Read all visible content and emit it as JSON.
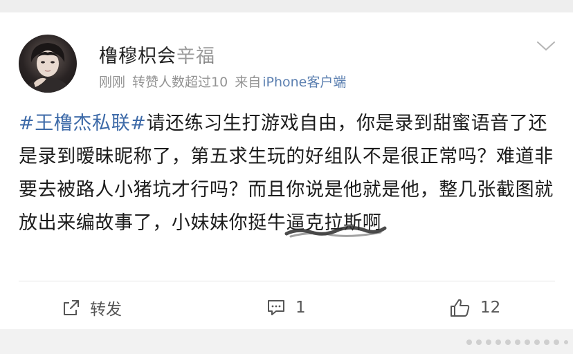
{
  "post": {
    "username": "橹穆枳会辛福",
    "time": "刚刚",
    "repost_note": "转赞人数超过10",
    "source_prefix": "来自",
    "source_app": "iPhone客户端",
    "hashtag": "#王橹杰私联#",
    "body": "请还练习生打游戏自由，你是录到甜蜜语音了还是录到暧昧昵称了，第五求生玩的好组队不是很正常吗？难道非要去被路人小猪坑才行吗？而且你说是他就是他，整几张截图就放出来编故事了，小妹妹你挺牛逼克拉斯啊"
  },
  "actions": {
    "repost_label": "转发",
    "comment_count": "1",
    "like_count": "12"
  },
  "icons": {
    "avatar": "avatar-photo",
    "menu": "chevron-down-icon",
    "repost": "share-icon",
    "comment": "comment-icon",
    "like": "thumbs-up-icon"
  },
  "colors": {
    "hashtag": "#3d6aa8",
    "source_app": "#5b7fb0",
    "meta": "#939393",
    "text": "#1c1c1c"
  }
}
